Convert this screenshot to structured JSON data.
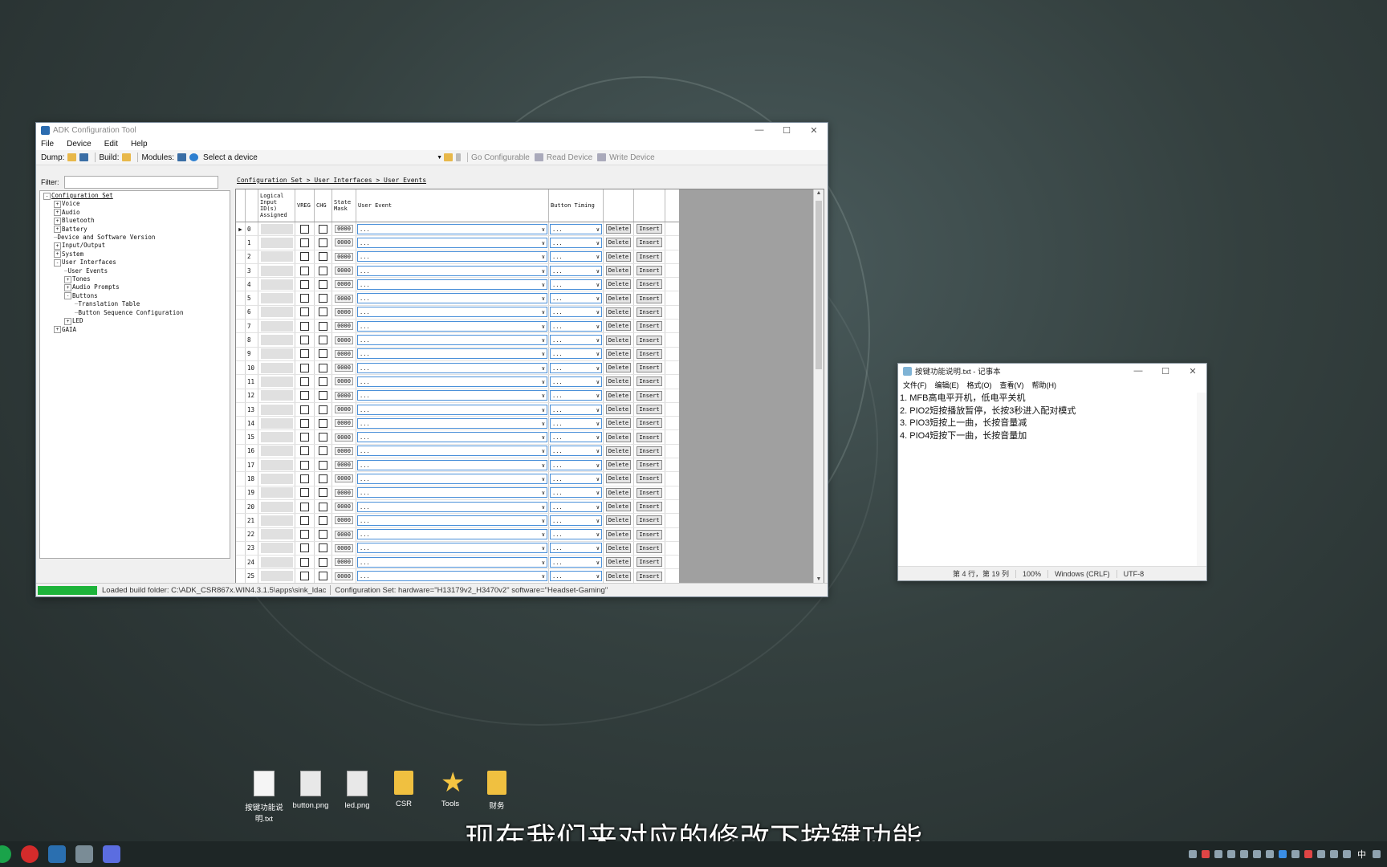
{
  "adk": {
    "title": "ADK Configuration Tool",
    "menu": [
      "File",
      "Device",
      "Edit",
      "Help"
    ],
    "toolbar": {
      "dump": "Dump:",
      "build": "Build:",
      "modules": "Modules:",
      "device_select": "Select a device",
      "go_configurable": "Go Configurable",
      "read_device": "Read Device",
      "write_device": "Write Device"
    },
    "filter_label": "Filter:",
    "breadcrumb": "Configuration Set > User Interfaces > User Events",
    "tree": [
      {
        "label": "Configuration Set",
        "depth": 0,
        "toggle": "-"
      },
      {
        "label": "Voice",
        "depth": 1,
        "toggle": "+"
      },
      {
        "label": "Audio",
        "depth": 1,
        "toggle": "+"
      },
      {
        "label": "Bluetooth",
        "depth": 1,
        "toggle": "+"
      },
      {
        "label": "Battery",
        "depth": 1,
        "toggle": "+"
      },
      {
        "label": "Device and Software Version",
        "depth": 1,
        "toggle": ""
      },
      {
        "label": "Input/Output",
        "depth": 1,
        "toggle": "+"
      },
      {
        "label": "System",
        "depth": 1,
        "toggle": "+"
      },
      {
        "label": "User Interfaces",
        "depth": 1,
        "toggle": "-"
      },
      {
        "label": "User Events",
        "depth": 2,
        "toggle": ""
      },
      {
        "label": "Tones",
        "depth": 2,
        "toggle": "+"
      },
      {
        "label": "Audio Prompts",
        "depth": 2,
        "toggle": "+"
      },
      {
        "label": "Buttons",
        "depth": 2,
        "toggle": "-"
      },
      {
        "label": "Translation Table",
        "depth": 3,
        "toggle": ""
      },
      {
        "label": "Button Sequence Configuration",
        "depth": 3,
        "toggle": ""
      },
      {
        "label": "LED",
        "depth": 2,
        "toggle": "+"
      },
      {
        "label": "GAIA",
        "depth": 1,
        "toggle": "+"
      }
    ],
    "grid": {
      "headers": {
        "logical": "Logical Input ID(s) Assigned",
        "vreg": "VREG",
        "chg": "CHG",
        "state": "State Mask",
        "event": "User Event",
        "timing": "Button Timing"
      },
      "row_indices": [
        "0",
        "1",
        "2",
        "3",
        "4",
        "5",
        "6",
        "7",
        "8",
        "9",
        "10",
        "11",
        "12",
        "13",
        "14",
        "15",
        "16",
        "17",
        "18",
        "19",
        "20",
        "21",
        "22",
        "23",
        "24",
        "25"
      ],
      "mask_value": "0000",
      "dropdown_value": "...",
      "delete_label": "Delete",
      "insert_label": "Insert"
    },
    "status": {
      "progress": 1.0,
      "loaded": "Loaded build folder: C:\\ADK_CSR867x.WIN4.3.1.5\\apps\\sink_ldac",
      "config": "Configuration Set: hardware=\"H13179v2_H3470v2\" software=\"Headset-Gaming\""
    }
  },
  "notepad": {
    "title": "按键功能说明.txt - 记事本",
    "menu": [
      "文件(F)",
      "编辑(E)",
      "格式(O)",
      "查看(V)",
      "帮助(H)"
    ],
    "lines": [
      "1. MFB高电平开机，低电平关机",
      "2. PIO2短按播放暂停，长按3秒进入配对模式",
      "3. PIO3短按上一曲，长按音量减",
      "4. PIO4短按下一曲，长按音量加"
    ],
    "status": {
      "pos": "第 4 行，第 19 列",
      "zoom": "100%",
      "eol": "Windows (CRLF)",
      "enc": "UTF-8"
    }
  },
  "desktop_icons": [
    {
      "label": "按键功能说明.txt",
      "icon": "txt"
    },
    {
      "label": "button.png",
      "icon": "png"
    },
    {
      "label": "led.png",
      "icon": "png"
    },
    {
      "label": "CSR",
      "icon": "folder"
    },
    {
      "label": "Tools",
      "icon": "star"
    },
    {
      "label": "财务",
      "icon": "folder"
    }
  ],
  "subtitle": "现在我们来对应的修改下按键功能",
  "tray": {
    "ime": "中"
  },
  "colors": {
    "progress": "#1db33a",
    "dropdown_border": "#4a90d9"
  }
}
